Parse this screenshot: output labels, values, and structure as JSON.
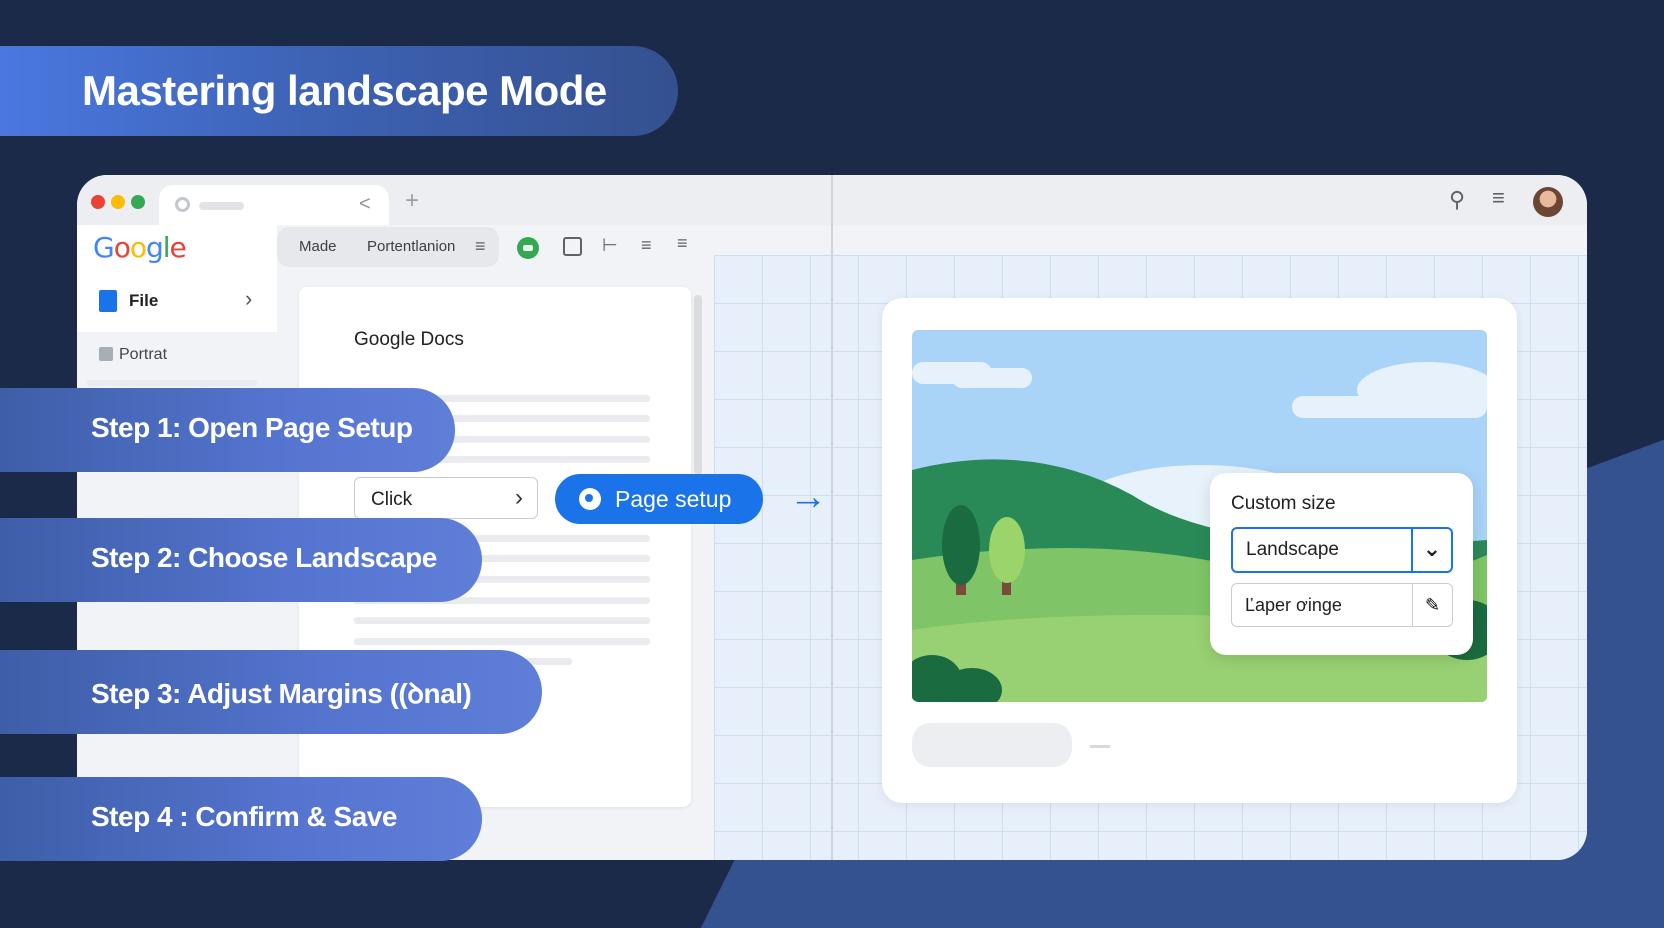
{
  "title": "Mastering landscape Mode",
  "browser": {
    "dots": [
      "#ea4335",
      "#fbbc04",
      "#34a853"
    ],
    "new_tab": "+",
    "back": "<"
  },
  "sidebar": {
    "logo": [
      "G",
      "o",
      "o",
      "g",
      "l",
      "e"
    ],
    "logo_colors": [
      "#4285f4",
      "#ea4335",
      "#fbbc04",
      "#4285f4",
      "#34a853",
      "#ea4335"
    ],
    "file_label": "File",
    "portrait_label": "Portrat"
  },
  "toolbar": {
    "item1": "Made",
    "item2": "Portentlanion"
  },
  "document": {
    "title": "Google Docs",
    "click_label": "Click"
  },
  "page_setup_button": "Page setup",
  "custom_size": {
    "title": "Custom size",
    "select_value": "Landscape",
    "input_value": "Ľaper ơinge"
  },
  "steps": [
    "Step 1: Open Page Setup",
    "Step 2: Choose Landscape",
    "Step 3: Adjust Margins ((ꝺnal)",
    "Step 4 : Confirm & Save"
  ]
}
